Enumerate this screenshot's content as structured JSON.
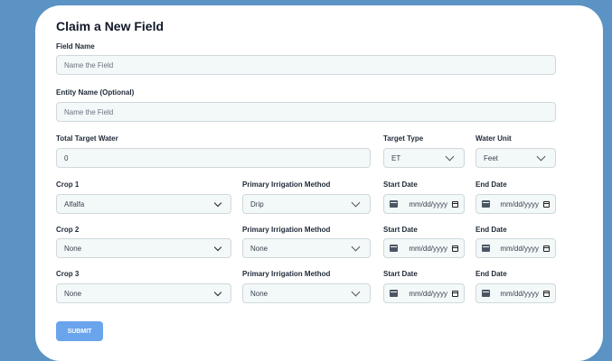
{
  "form": {
    "title": "Claim a New Field",
    "field_name": {
      "label": "Field Name",
      "placeholder": "Name the Field"
    },
    "entity_name": {
      "label": "Entity Name (Optional)",
      "placeholder": "Name the Field"
    },
    "total_target_water": {
      "label": "Total Target Water",
      "value": "0"
    },
    "target_type": {
      "label": "Target Type",
      "value": "ET"
    },
    "water_unit": {
      "label": "Water Unit",
      "value": "Feet"
    },
    "crops": [
      {
        "crop_label": "Crop 1",
        "crop_value": "Alfalfa",
        "irr_label": "Primary Irrigation Method",
        "irr_value": "Drip",
        "start_label": "Start Date",
        "start_value": "mm/dd/yyyy",
        "end_label": "End Date",
        "end_value": "mm/dd/yyyy"
      },
      {
        "crop_label": "Crop 2",
        "crop_value": "None",
        "irr_label": "Primary Irrigation Method",
        "irr_value": "None",
        "start_label": "Start Date",
        "start_value": "mm/dd/yyyy",
        "end_label": "End Date",
        "end_value": "mm/dd/yyyy"
      },
      {
        "crop_label": "Crop 3",
        "crop_value": "None",
        "irr_label": "Primary Irrigation Method",
        "irr_value": "None",
        "start_label": "Start Date",
        "start_value": "mm/dd/yyyy",
        "end_label": "End Date",
        "end_value": "mm/dd/yyyy"
      }
    ],
    "submit_label": "SUBMIT"
  },
  "colors": {
    "background": "#5b93c4",
    "card": "#ffffff",
    "input_bg": "#f3f8f8",
    "submit": "#6aa4ec"
  }
}
